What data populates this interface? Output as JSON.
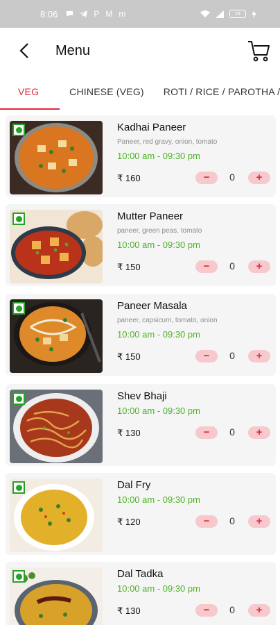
{
  "status_bar": {
    "time": "8:06",
    "left_icons": [
      "message-icon",
      "telegram-icon",
      "p-icon",
      "m-icon",
      "m-icon"
    ],
    "battery": "28"
  },
  "app_bar": {
    "title": "Menu",
    "back_icon": "chevron-left-icon",
    "cart_icon": "cart-icon"
  },
  "tabs": [
    {
      "label": "VEG",
      "active": true
    },
    {
      "label": "CHINESE (VEG)",
      "active": false
    },
    {
      "label": "ROTI / RICE / PAROTHA /",
      "active": false
    }
  ],
  "colors": {
    "accent": "#e0263a",
    "time_green": "#4fb228",
    "veg_green": "#2aa02a",
    "card_bg": "#f5f5f5",
    "qty_btn_bg": "#f7c9cd"
  },
  "items": [
    {
      "name": "Kadhai Paneer",
      "desc": "Paneer, red gravy, onion, tomato",
      "time": "10:00 am - 09:30 pm",
      "price": "₹ 160",
      "qty": "0",
      "minus": "−",
      "plus": "+"
    },
    {
      "name": "Mutter Paneer",
      "desc": "paneer, green peas, tomato",
      "time": "10:00 am - 09:30 pm",
      "price": "₹ 150",
      "qty": "0",
      "minus": "−",
      "plus": "+"
    },
    {
      "name": "Paneer  Masala",
      "desc": "paneer, capsicum, tomato, onion",
      "time": "10:00 am - 09:30 pm",
      "price": "₹ 150",
      "qty": "0",
      "minus": "−",
      "plus": "+"
    },
    {
      "name": "Shev Bhaji",
      "desc": "",
      "time": "10:00 am - 09:30 pm",
      "price": "₹ 130",
      "qty": "0",
      "minus": "−",
      "plus": "+"
    },
    {
      "name": "Dal Fry",
      "desc": "",
      "time": "10:00 am - 09:30 pm",
      "price": "₹ 120",
      "qty": "0",
      "minus": "−",
      "plus": "+"
    },
    {
      "name": "Dal Tadka",
      "desc": "",
      "time": "10:00 am - 09:30 pm",
      "price": "₹ 130",
      "qty": "0",
      "minus": "−",
      "plus": "+"
    }
  ]
}
